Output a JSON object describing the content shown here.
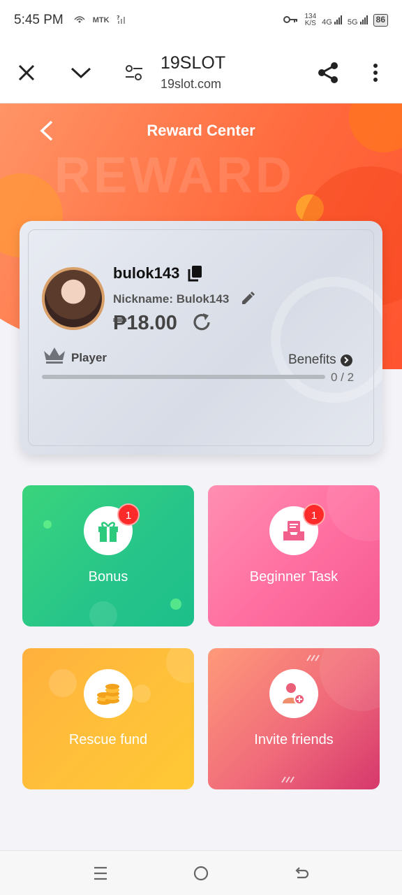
{
  "status_bar": {
    "time": "5:45 PM",
    "left_icons": [
      "notification-icon",
      "MTK",
      "signal-question-icon"
    ],
    "net_speed_value": "134",
    "net_speed_unit": "K/S",
    "network_1": "4G",
    "network_2": "5G",
    "battery": "86"
  },
  "browser": {
    "title": "19SLOT",
    "url": "19slot.com"
  },
  "header": {
    "title": "Reward Center",
    "watermark": "REWARD"
  },
  "profile": {
    "username": "bulok143",
    "nickname": "Nickname: Bulok143",
    "balance": "₱18.00",
    "level": "Player",
    "benefits_label": "Benefits",
    "progress_text": "0 / 2",
    "progress_fraction": 0
  },
  "tiles": [
    {
      "label": "Bonus",
      "badge": "1",
      "icon": "gift-icon",
      "color": "#2ccb80"
    },
    {
      "label": "Beginner Task",
      "badge": "1",
      "icon": "inbox-task-icon",
      "color": "#ff6ea0"
    },
    {
      "label": "Rescue fund",
      "badge": "",
      "icon": "coins-icon",
      "color": "#ffbb38"
    },
    {
      "label": "Invite friends",
      "badge": "",
      "icon": "add-user-icon",
      "color": "#ec5f79"
    }
  ],
  "colors": {
    "accent": "#ff6a3d",
    "badge": "#ff2b2b"
  }
}
